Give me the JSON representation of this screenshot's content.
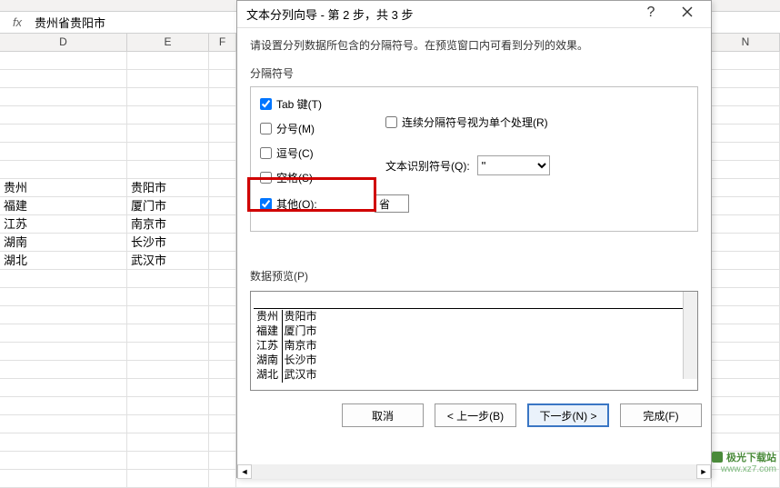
{
  "formula_bar": {
    "fx_label": "fx",
    "value": "贵州省贵阳市"
  },
  "columns": {
    "D": "D",
    "E": "E",
    "F": "F",
    "N": "N"
  },
  "sheet_rows": [
    {
      "d": "",
      "e": ""
    },
    {
      "d": "",
      "e": ""
    },
    {
      "d": "",
      "e": ""
    },
    {
      "d": "",
      "e": ""
    },
    {
      "d": "",
      "e": ""
    },
    {
      "d": "",
      "e": ""
    },
    {
      "d": "",
      "e": ""
    },
    {
      "d": "贵州",
      "e": "贵阳市"
    },
    {
      "d": "福建",
      "e": "厦门市"
    },
    {
      "d": "江苏",
      "e": "南京市"
    },
    {
      "d": "湖南",
      "e": "长沙市"
    },
    {
      "d": "湖北",
      "e": "武汉市"
    },
    {
      "d": "",
      "e": ""
    },
    {
      "d": "",
      "e": ""
    },
    {
      "d": "",
      "e": ""
    },
    {
      "d": "",
      "e": ""
    },
    {
      "d": "",
      "e": ""
    },
    {
      "d": "",
      "e": ""
    },
    {
      "d": "",
      "e": ""
    },
    {
      "d": "",
      "e": ""
    },
    {
      "d": "",
      "e": ""
    },
    {
      "d": "",
      "e": ""
    },
    {
      "d": "",
      "e": ""
    },
    {
      "d": "",
      "e": ""
    }
  ],
  "dialog": {
    "title": "文本分列向导 - 第 2 步，共 3 步",
    "help_symbol": "?",
    "instruction": "请设置分列数据所包含的分隔符号。在预览窗口内可看到分列的效果。",
    "delimiter_group_label": "分隔符号",
    "delimiters": {
      "tab_label": "Tab 键(T)",
      "semicolon_label": "分号(M)",
      "comma_label": "逗号(C)",
      "space_label": "空格(S)",
      "other_label": "其他(O):",
      "other_value": "省"
    },
    "consecutive_label": "连续分隔符号视为单个处理(R)",
    "qualifier_label": "文本识别符号(Q):",
    "qualifier_value": "\"",
    "preview_label": "数据预览(P)",
    "preview_rows": [
      {
        "c1": "贵州",
        "c2": "贵阳市"
      },
      {
        "c1": "福建",
        "c2": "厦门市"
      },
      {
        "c1": "江苏",
        "c2": "南京市"
      },
      {
        "c1": "湖南",
        "c2": "长沙市"
      },
      {
        "c1": "湖北",
        "c2": "武汉市"
      }
    ],
    "buttons": {
      "cancel": "取消",
      "back": "< 上一步(B)",
      "next": "下一步(N) >",
      "finish": "完成(F)"
    }
  },
  "watermark": {
    "name": "极光下载站",
    "url": "www.xz7.com"
  }
}
